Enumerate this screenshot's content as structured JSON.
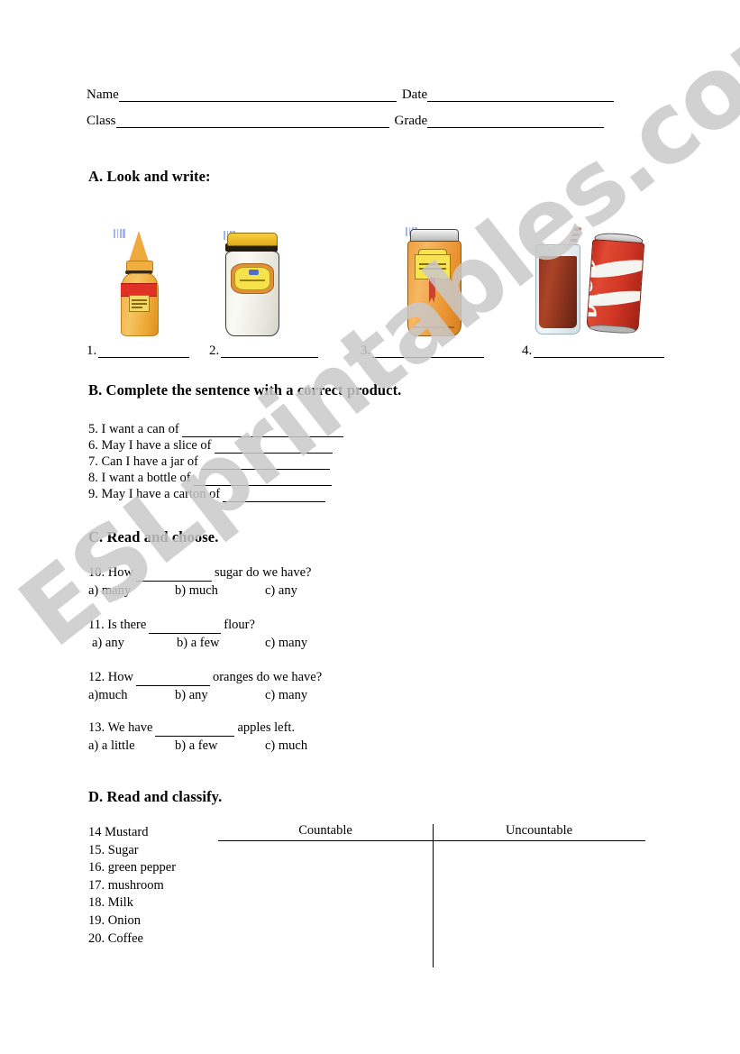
{
  "header": {
    "name_label": "Name",
    "date_label": "Date",
    "class_label": "Class",
    "grade_label": "Grade"
  },
  "watermark": {
    "text": "ESLprintables.com",
    "color": "#c9c9c9"
  },
  "section_a": {
    "heading": "A. Look and write:",
    "pictures": [
      {
        "number": "1.",
        "item": "mustard-bottle"
      },
      {
        "number": "2.",
        "item": "mayonnaise-jar"
      },
      {
        "number": "3.",
        "item": "jam-jar"
      },
      {
        "number": "4.",
        "item": "cola-glass-and-can"
      }
    ],
    "can_script": "Cola"
  },
  "section_b": {
    "heading": "B. Complete the sentence with a correct product.",
    "items": [
      {
        "text": "5. I want a can of",
        "line_width": 179
      },
      {
        "text": "6. May I have a slice of",
        "line_width": 131
      },
      {
        "text": "7. Can I have a jar of",
        "line_width": 143
      },
      {
        "text": "8. I want a bottle of",
        "line_width": 153
      },
      {
        "text": "9. May I have a carton of",
        "line_width": 114
      }
    ]
  },
  "section_c": {
    "heading": "C. Read and choose.",
    "questions": [
      {
        "prefix": "10. How",
        "suffix": "sugar do we have?",
        "blank_width": 84,
        "options": [
          "a) many",
          "b) much",
          "c) any"
        ]
      },
      {
        "prefix": "11. Is there",
        "suffix": "flour?",
        "blank_width": 80,
        "options": [
          "a) any",
          "b) a few",
          "c) many"
        ]
      },
      {
        "prefix": "12. How",
        "suffix": "oranges do we have?",
        "blank_width": 82,
        "options": [
          "a)much",
          "b) any",
          "c) many"
        ]
      },
      {
        "prefix": "13. We have",
        "suffix": "apples left.",
        "blank_width": 88,
        "options": [
          "a) a little",
          "b) a few",
          "c) much"
        ]
      }
    ]
  },
  "section_d": {
    "heading": "D. Read and classify.",
    "words": [
      "14 Mustard",
      "15. Sugar",
      "16. green pepper",
      "17. mushroom",
      "18. Milk",
      "19. Onion",
      "20. Coffee"
    ],
    "table": {
      "countable_header": "Countable",
      "uncountable_header": "Uncountable"
    }
  }
}
